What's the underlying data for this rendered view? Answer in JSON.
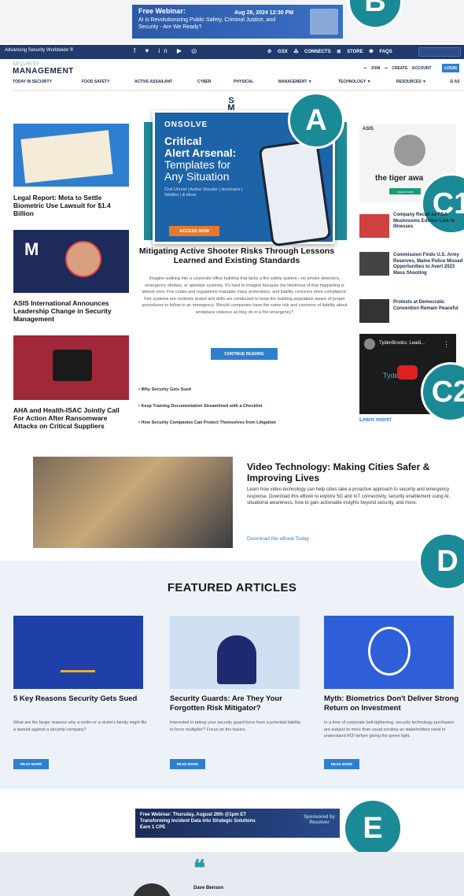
{
  "webinar_top": {
    "title": "Free Webinar:",
    "date": "Aug 28, 2024 12:30 PM",
    "subtitle": "AI is Revolutionizing Public Safety, Criminal Justice, and Security - Are We Ready?"
  },
  "badges": {
    "a": "A",
    "b": "B",
    "c1": "C1",
    "c2": "C2",
    "d": "D",
    "e": "E"
  },
  "topnav": {
    "tagline": "Advancing Security Worldwide ®",
    "social": "f  ♥  in  ▶  ◎",
    "links": "⚙ GSX  ⁂ CONNECTS  ⊞ STORE  ❶ FAQS"
  },
  "site": {
    "logo_top": "SECURITY",
    "logo": "MANAGEMENT"
  },
  "account": {
    "join": "⇾ JOIN",
    "create": "⇾ CREATE ACCOUNT",
    "login": "LOGIN"
  },
  "menu": {
    "items": [
      "TODAY IN SECURITY",
      "FOOD SAFETY",
      "ACTIVE ASSAILANT",
      "CYBER",
      "PHYSICAL",
      "MANAGEMENT ▼",
      "TECHNOLOGY ▼",
      "RESOURCES ▼",
      "☑ AS"
    ]
  },
  "center_logo": "S\nM",
  "left_articles": [
    {
      "title": "Legal Report: Meta to Settle Biometric Use Lawsuit for $1.4 Billion"
    },
    {
      "title": "ASIS International Announces Leadership Change in Security Management"
    },
    {
      "title": "AHA and Health-ISAC Jointly Call For Action After Ransomware Attacks on Critical Suppliers"
    }
  ],
  "ad": {
    "brand": "ONSOLVE",
    "line1": "Critical",
    "line2": "Alert Arsenal:",
    "line3": "Templates for",
    "line4": "Any Situation",
    "sub": "Civil Unrest | Active Shooter | Hurricane | Wildfire | & More",
    "button": "ACCESS NOW"
  },
  "main_article": {
    "title": "Mitigating Active Shooter Risks Through Lessons Learned and Existing Standards",
    "body": "Imagine walking into a corporate office building that lacks a fire safety system—no smoke detectors, emergency strobes, or sprinkler systems. It's hard to imagine because the likelihood of that happening is almost zero. Fire codes and regulations mandate many protections, and liability concerns drive compliance. Fire systems are routinely tested and drills are conducted to keep the building population aware of proper procedures to follow in an emergency. Should companies have the same risk and concerns of liability about workplace violence as they do in a fire emergency?",
    "button": "CONTINUE READING"
  },
  "bullet_links": [
    "•   Why Security Gets Sued",
    "•   Keep Training Documentation Streamlined with a Checklist",
    "•   How Security Companies Can Protect Themselves from Litigation"
  ],
  "right_ad": {
    "title": "the tiger awa",
    "button": "Learn more",
    "org": "ASIS"
  },
  "right_articles": [
    {
      "title": "Company Recall as FDA Mushrooms Edibles Link to Illnesses"
    },
    {
      "title": "Commission Finds U.S. Army Reserves, Maine Police Missed Opportunities to Avert 2023 Mass Shooting"
    },
    {
      "title": "Protests at Democratic Convention Remain Peaceful"
    }
  ],
  "video": {
    "title": "TydenBrooks: Leadi...",
    "menu": "⋮",
    "overlay": "Tyden",
    "learn": "Learn more!"
  },
  "video_tech": {
    "title": "Video Technology: Making Cities Safer & Improving Lives",
    "body": "Learn how video technology can help cities take a proactive approach to security and emergency response. Download this eBook to explore 5G and IoT connectivity, security enablement using AI, situational awareness, how to gain actionable insights beyond security, and more.",
    "link": "Download the eBook Today"
  },
  "featured": {
    "heading": "FEATURED ARTICLES",
    "items": [
      {
        "title": "5 Key Reasons Security Gets Sued",
        "body": "What are the larger reasons why a victim or a victim's family might file a lawsuit against a security company?",
        "button": "READ MORE"
      },
      {
        "title": "Security Guards: Are They Your Forgotten Risk Mitigator?",
        "body": "Interested in taking your security guard force from a potential liability to force multiplier? Focus on the basics.",
        "button": "READ MORE"
      },
      {
        "title": "Myth: Biometrics Don't Deliver Strong Return on Investment",
        "body": "In a time of corporate belt-tightening, security technology purchases are subject to more than usual scrutiny as stakeholders need to understand ROI before giving the green light.",
        "button": "READ MORE"
      }
    ]
  },
  "webinar_bottom": {
    "line1": "Free Webinar: Thursday, August 29th @1pm ET",
    "line2": "Transforming Incident Data into Strategic Solutions",
    "line3": "Earn 1 CPE",
    "sponsor_label": "Sponsored by",
    "sponsor": "Resolver"
  },
  "testimonial": {
    "quote": "❝",
    "name": "Dave Benson"
  },
  "colors": {
    "brand": "#1f3a6b",
    "accent": "#2f7fd0",
    "badge": "#1a8a96"
  }
}
